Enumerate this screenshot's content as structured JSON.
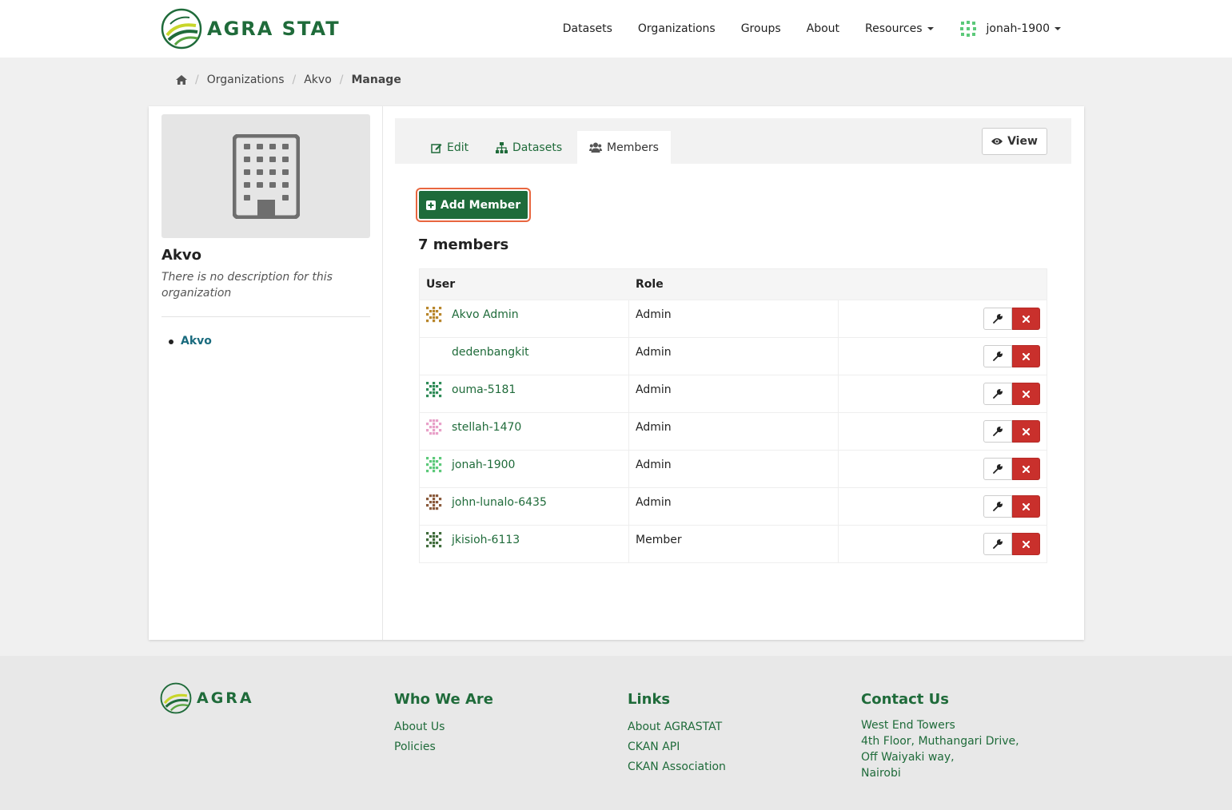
{
  "header": {
    "brand": "AGRA STAT",
    "nav": [
      "Datasets",
      "Organizations",
      "Groups",
      "About",
      "Resources"
    ],
    "user": "jonah-1900"
  },
  "breadcrumb": {
    "home_icon": "home-icon",
    "items": [
      "Organizations",
      "Akvo",
      "Manage"
    ]
  },
  "org": {
    "name": "Akvo",
    "description": "There is no description for this organization",
    "links": [
      "Akvo"
    ]
  },
  "tabs": {
    "edit": "Edit",
    "datasets": "Datasets",
    "members": "Members",
    "view": "View"
  },
  "actions": {
    "add_member": "Add Member"
  },
  "members": {
    "count_label": "7 members",
    "columns": [
      "User",
      "Role"
    ],
    "rows": [
      {
        "user": "Akvo Admin",
        "role": "Admin",
        "avatar_color": "#b8862b"
      },
      {
        "user": "dedenbangkit",
        "role": "Admin",
        "avatar_color": ""
      },
      {
        "user": "ouma-5181",
        "role": "Admin",
        "avatar_color": "#2e8b57"
      },
      {
        "user": "stellah-1470",
        "role": "Admin",
        "avatar_color": "#e8a0c8"
      },
      {
        "user": "jonah-1900",
        "role": "Admin",
        "avatar_color": "#5cc97a"
      },
      {
        "user": "john-lunalo-6435",
        "role": "Admin",
        "avatar_color": "#8a5a3c"
      },
      {
        "user": "jkisioh-6113",
        "role": "Member",
        "avatar_color": "#3f6b3a"
      }
    ]
  },
  "footer": {
    "brand": "AGRA",
    "who": {
      "title": "Who We Are",
      "links": [
        "About Us",
        "Policies"
      ]
    },
    "links": {
      "title": "Links",
      "links": [
        "About AGRASTAT",
        "CKAN API",
        "CKAN Association"
      ]
    },
    "contact": {
      "title": "Contact Us",
      "lines": [
        "West End Towers",
        "4th Floor, Muthangari Drive,",
        "Off Waiyaki way,",
        "Nairobi"
      ]
    }
  },
  "colors": {
    "brand_green": "#1f6b3a",
    "danger": "#c9302c",
    "link_teal": "#1a6b7e"
  }
}
